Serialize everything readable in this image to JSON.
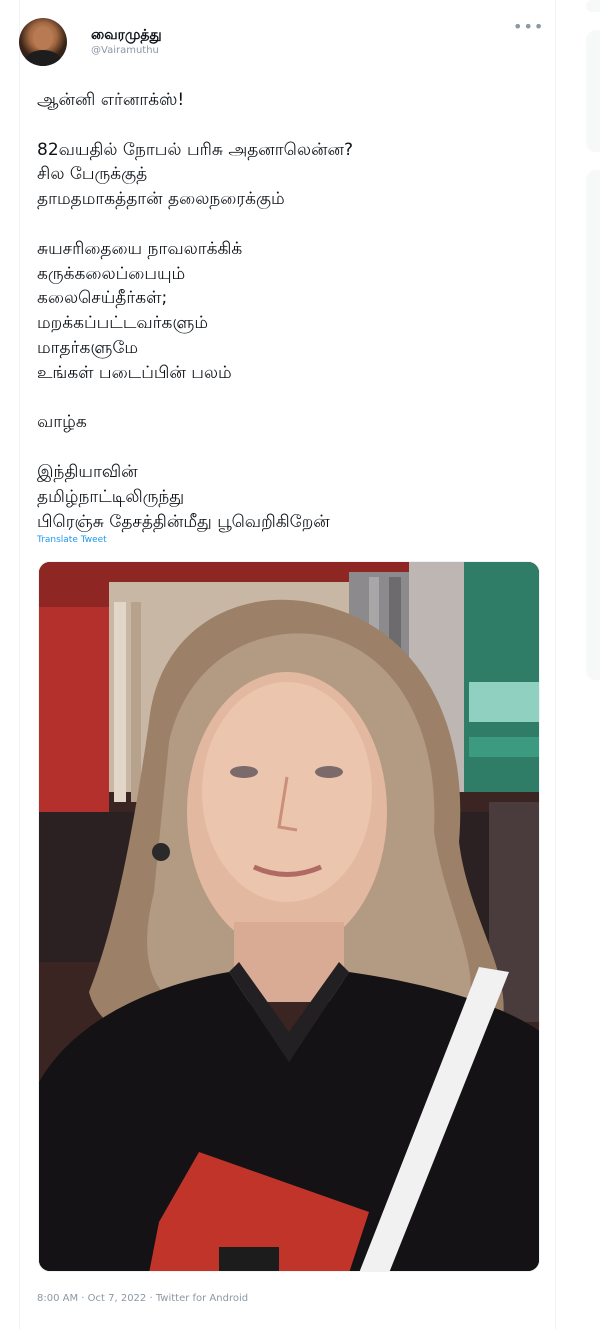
{
  "tweet": {
    "author": {
      "display_name": "வைரமுத்து",
      "handle": "@Vairamuthu"
    },
    "more_icon": "•••",
    "lines": [
      "ஆன்னி எர்னாக்ஸ்!",
      "",
      "82வயதில் நோபல் பரிசு அதனாலென்ன?",
      "சில பேருக்குத்",
      "தாமதமாகத்தான் தலைநரைக்கும்",
      "",
      "சுயசரிதையை நாவலாக்கிக்",
      "கருக்கலைப்பையும்",
      "கலைசெய்தீர்கள்;",
      "மறக்கப்பட்டவர்களும்",
      "மாதர்களுமே",
      "உங்கள் படைப்பின் பலம்",
      "",
      "வாழ்க",
      "",
      "இந்தியாவின்",
      "தமிழ்நாட்டிலிருந்து",
      "பிரெஞ்சு தேசத்தின்மீது பூவெறிகிறேன்"
    ],
    "translate_label": "Translate Tweet",
    "timestamp": "8:00 AM · Oct 7, 2022 · Twitter for Android"
  },
  "colors": {
    "text": "#0f1419",
    "secondary": "#8b98a5",
    "link": "#1d9bf0",
    "border": "#eff3f4"
  }
}
